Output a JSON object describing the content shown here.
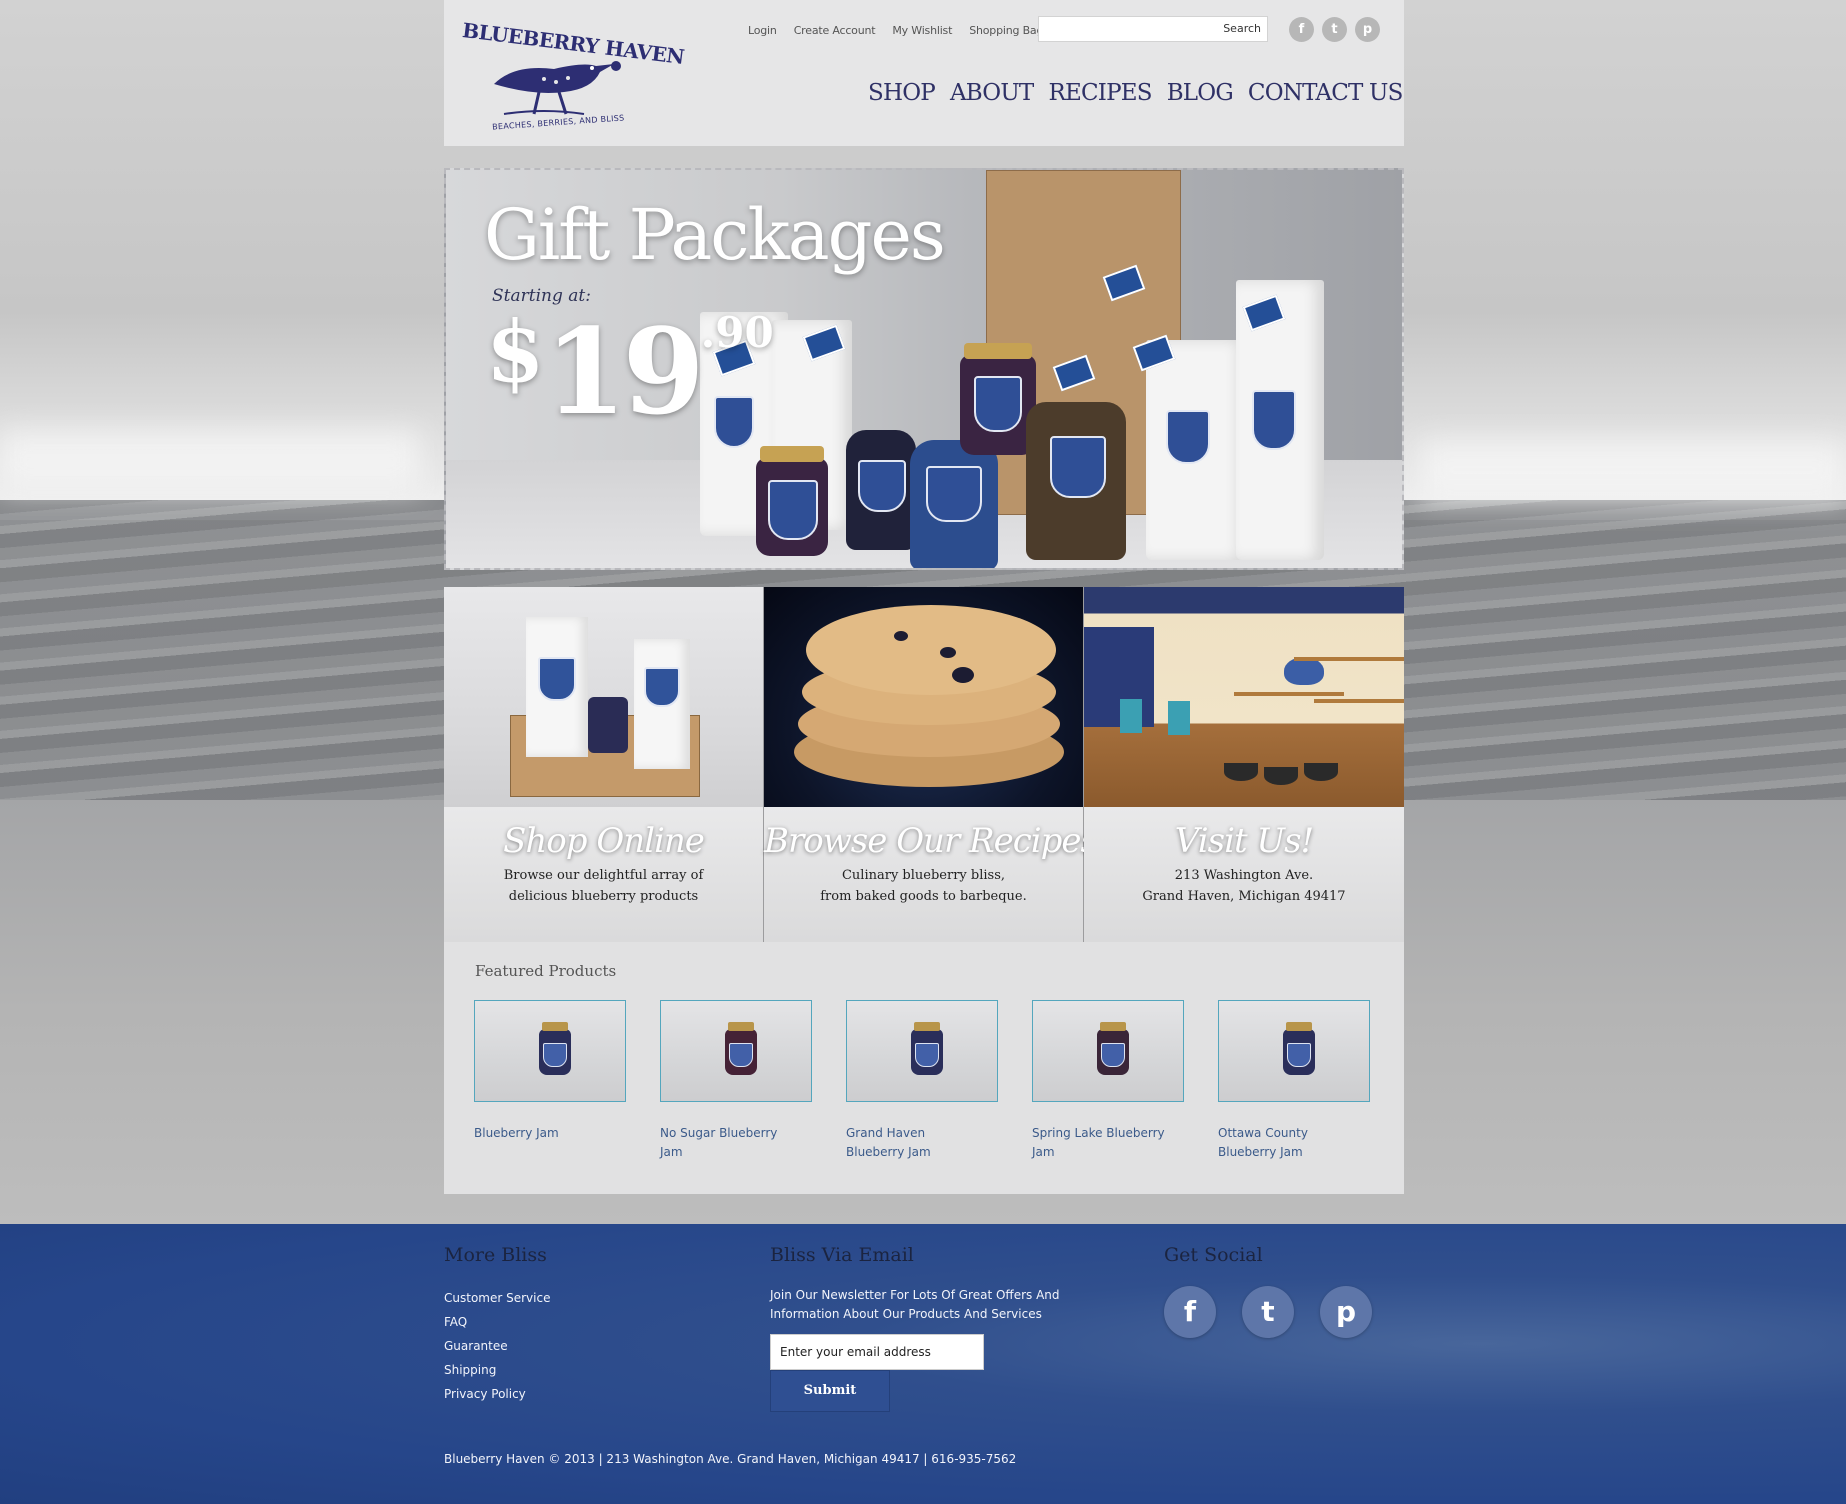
{
  "brand": {
    "name": "BLUEBERRY HAVEN",
    "tagline": "BEACHES, BERRIES, AND BLISS"
  },
  "utility_links": [
    "Login",
    "Create Account",
    "My Wishlist",
    "Shopping Bag"
  ],
  "search": {
    "placeholder": "",
    "button_label": "Search"
  },
  "top_social": [
    "f",
    "t",
    "p"
  ],
  "nav": [
    "SHOP",
    "ABOUT",
    "RECIPES",
    "BLOG",
    "CONTACT US"
  ],
  "hero": {
    "title": "Gift Packages",
    "starting": "Starting at:",
    "price_currency": "$",
    "price_integer": "19",
    "price_decimal": ".90"
  },
  "tiles": [
    {
      "title": "Shop Online",
      "line1": "Browse our delightful array of",
      "line2": "delicious blueberry products"
    },
    {
      "title": "Browse Our Recipes",
      "line1": "Culinary blueberry bliss,",
      "line2": "from baked goods to barbeque."
    },
    {
      "title": "Visit Us!",
      "line1": "213 Washington Ave.",
      "line2": "Grand Haven, Michigan 49417"
    }
  ],
  "featured": {
    "heading": "Featured Products",
    "products": [
      {
        "name": "Blueberry Jam"
      },
      {
        "name": "No Sugar Blueberry Jam"
      },
      {
        "name": "Grand Haven Blueberry Jam"
      },
      {
        "name": "Spring Lake Blueberry Jam"
      },
      {
        "name": "Ottawa County Blueberry Jam"
      }
    ]
  },
  "footer": {
    "more_bliss": {
      "heading": "More Bliss",
      "links": [
        "Customer Service",
        "FAQ",
        "Guarantee",
        "Shipping",
        "Privacy Policy"
      ]
    },
    "email": {
      "heading": "Bliss Via Email",
      "text": "Join Our Newsletter For Lots Of Great Offers And Information About Our Products And Services",
      "input_value": "Enter your email address",
      "submit_label": "Submit"
    },
    "social": {
      "heading": "Get Social",
      "icons": [
        "f",
        "t",
        "p"
      ]
    },
    "copyright": "Blueberry Haven © 2013 | 213 Washington Ave. Grand Haven, Michigan 49417 | 616-935-7562"
  },
  "colors": {
    "brand_navy": "#2d2e73",
    "footer_blue": "#26468a",
    "featured_border": "#54a6bd"
  },
  "icons": {
    "logo_bird": "bird-logo-icon",
    "facebook": "facebook-icon",
    "twitter": "twitter-icon",
    "pinterest": "pinterest-icon"
  }
}
